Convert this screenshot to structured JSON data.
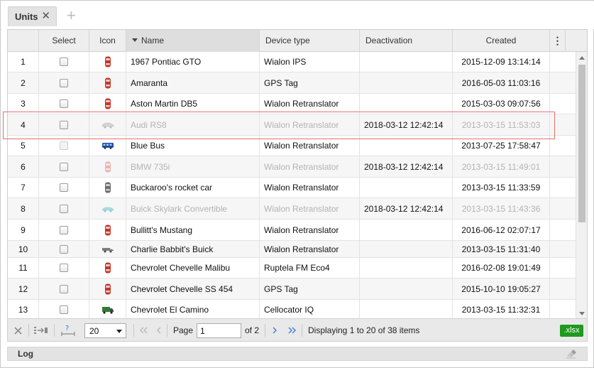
{
  "tab": {
    "label": "Units",
    "close": "✕",
    "add": "+"
  },
  "grid": {
    "columns": {
      "select": "Select",
      "icon": "Icon",
      "name": "Name",
      "device": "Device type",
      "deactivation": "Deactivation",
      "created": "Created",
      "menu": "⋮"
    },
    "rows": [
      {
        "num": "1",
        "name": "1967 Pontiac GTO",
        "device": "Wialon IPS",
        "deactivation": "",
        "created": "2015-12-09 13:14:14",
        "icon": "red-car-icon",
        "dim": false,
        "chk_disabled": false
      },
      {
        "num": "2",
        "name": "Amaranta",
        "device": "GPS Tag",
        "deactivation": "",
        "created": "2016-05-03 11:03:16",
        "icon": "red-car-icon",
        "dim": false,
        "chk_disabled": false
      },
      {
        "num": "3",
        "name": "Aston Martin DB5",
        "device": "Wialon Retranslator",
        "deactivation": "",
        "created": "2015-03-03 09:07:56",
        "icon": "red-car-icon",
        "dim": false,
        "chk_disabled": false
      },
      {
        "num": "4",
        "name": "Audi RS8",
        "device": "Wialon Retranslator",
        "deactivation": "2018-03-12 12:42:14",
        "created": "2013-03-15 11:53:03",
        "icon": "gray-sedan-icon",
        "dim": true,
        "chk_disabled": false
      },
      {
        "num": "5",
        "name": "Blue Bus",
        "device": "Wialon Retranslator",
        "deactivation": "",
        "created": "2013-07-25 17:58:47",
        "icon": "blue-bus-icon",
        "dim": false,
        "chk_disabled": true
      },
      {
        "num": "6",
        "name": "BMW 735i",
        "device": "Wialon Retranslator",
        "deactivation": "2018-03-12 12:42:14",
        "created": "2013-03-15 11:49:01",
        "icon": "pink-car-icon",
        "dim": true,
        "chk_disabled": false
      },
      {
        "num": "7",
        "name": "Buckaroo's rocket car",
        "device": "Wialon Retranslator",
        "deactivation": "",
        "created": "2013-03-15 11:33:59",
        "icon": "gray-car-icon",
        "dim": false,
        "chk_disabled": false
      },
      {
        "num": "8",
        "name": "Buick Skylark Convertible",
        "device": "Wialon Retranslator",
        "deactivation": "2018-03-12 12:42:14",
        "created": "2013-03-15 11:43:36",
        "icon": "cyan-car-icon",
        "dim": true,
        "chk_disabled": false
      },
      {
        "num": "9",
        "name": "Bullitt's Mustang",
        "device": "Wialon Retranslator",
        "deactivation": "",
        "created": "2016-06-12 02:07:17",
        "icon": "red-car-icon",
        "dim": false,
        "chk_disabled": false
      },
      {
        "num": "10",
        "name": "Charlie Babbit's Buick",
        "device": "Wialon Retranslator",
        "deactivation": "",
        "created": "2013-03-15 11:31:40",
        "icon": "gray-van-icon",
        "dim": false,
        "chk_disabled": false
      },
      {
        "num": "11",
        "name": "Chevrolet Chevelle Malibu",
        "device": "Ruptela FM Eco4",
        "deactivation": "",
        "created": "2016-02-08 19:01:49",
        "icon": "red-car-icon",
        "dim": false,
        "chk_disabled": false
      },
      {
        "num": "12",
        "name": "Chevrolet Chevelle SS 454",
        "device": "GPS Tag",
        "deactivation": "",
        "created": "2015-10-10 19:05:27",
        "icon": "red-car-icon",
        "dim": false,
        "chk_disabled": false
      },
      {
        "num": "13",
        "name": "Chevrolet El Camino",
        "device": "Cellocator IQ",
        "deactivation": "",
        "created": "2013-03-15 11:32:31",
        "icon": "green-truck-icon",
        "dim": false,
        "chk_disabled": false
      }
    ]
  },
  "toolbar": {
    "page_size": "20",
    "page_label": "Page",
    "page_value": "1",
    "of_pages": "of 2",
    "displaying": "Displaying 1 to 20 of 38 items",
    "export": ".xlsx"
  },
  "log": {
    "label": "Log"
  },
  "colors": {
    "selected_outline": "#e07070",
    "export_green": "#1f9a1f",
    "accent_blue": "#3b7dd8"
  }
}
